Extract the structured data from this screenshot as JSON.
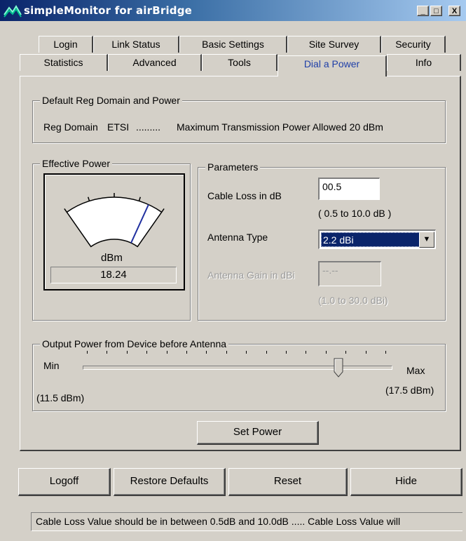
{
  "window": {
    "title": "simpleMonitor for airBridge",
    "controls": {
      "minimize": "_",
      "maximize": "□",
      "close": "X"
    }
  },
  "tabs": {
    "row1": [
      "Login",
      "Link Status",
      "Basic Settings",
      "Site Survey",
      "Security"
    ],
    "row2": [
      "Statistics",
      "Advanced",
      "Tools",
      "Dial a Power",
      "Info"
    ],
    "active": "Dial a Power"
  },
  "default_domain": {
    "group_label": "Default Reg Domain and Power",
    "reg_domain_label": "Reg Domain",
    "reg_domain_value": "ETSI",
    "separator": ".........",
    "max_power_text": "Maximum Transmission Power Allowed 20 dBm"
  },
  "effective_power": {
    "group_label": "Effective Power",
    "unit": "dBm",
    "value": "18.24",
    "needle_fraction": 0.85
  },
  "parameters": {
    "group_label": "Parameters",
    "cable_loss_label": "Cable Loss in dB",
    "cable_loss_value": "00.5",
    "cable_loss_range": "( 0.5 to 10.0 dB )",
    "antenna_type_label": "Antenna Type",
    "antenna_type_value": "2.2 dBi",
    "antenna_gain_label": "Antenna Gain in dBi",
    "antenna_gain_value": "--.--",
    "antenna_gain_range": "(1.0 to 30.0 dBi)"
  },
  "output_power": {
    "group_label": "Output Power from Device before Antenna",
    "min_label": "Min",
    "max_label": "Max",
    "min_value": "(11.5 dBm)",
    "max_value": "(17.5 dBm)",
    "slider_fraction": 0.83,
    "tick_count": 16
  },
  "buttons": {
    "set_power": "Set Power",
    "logoff": "Logoff",
    "restore_defaults": "Restore Defaults",
    "reset": "Reset",
    "hide": "Hide"
  },
  "status_text": "Cable Loss Value should be in between 0.5dB and 10.0dB ..... Cable Loss Value will"
}
